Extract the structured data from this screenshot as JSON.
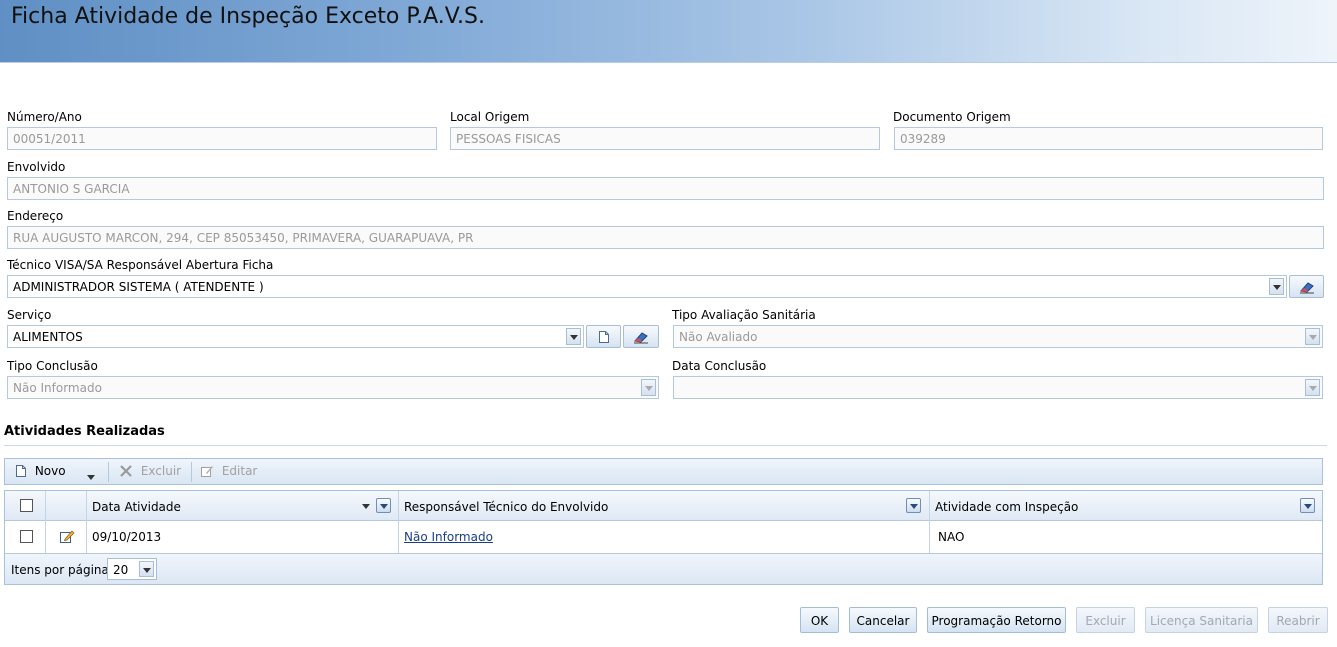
{
  "header": {
    "title": "Ficha Atividade de Inspeção Exceto P.A.V.S."
  },
  "form": {
    "numero_ano": {
      "label": "Número/Ano",
      "value": "00051/2011"
    },
    "local_origem": {
      "label": "Local Origem",
      "value": "PESSOAS FISICAS"
    },
    "documento_origem": {
      "label": "Documento Origem",
      "value": "039289"
    },
    "envolvido": {
      "label": "Envolvido",
      "value": "ANTONIO S GARCIA"
    },
    "endereco": {
      "label": "Endereço",
      "value": "RUA AUGUSTO MARCON, 294, CEP 85053450, PRIMAVERA, GUARAPUAVA, PR"
    },
    "tecnico": {
      "label": "Técnico VISA/SA Responsável Abertura Ficha",
      "value": "ADMINISTRADOR SISTEMA ( ATENDENTE )"
    },
    "servico": {
      "label": "Serviço",
      "value": "ALIMENTOS"
    },
    "tipo_avaliacao": {
      "label": "Tipo Avaliação Sanitária",
      "value": "Não Avaliado"
    },
    "tipo_conclusao": {
      "label": "Tipo Conclusão",
      "value": "Não Informado"
    },
    "data_conclusao": {
      "label": "Data Conclusão",
      "value": ""
    }
  },
  "activities": {
    "title": "Atividades Realizadas",
    "toolbar": {
      "novo": "Novo",
      "excluir": "Excluir",
      "editar": "Editar"
    },
    "columns": [
      "Data Atividade",
      "Responsável Técnico do Envolvido",
      "Atividade com Inspeção"
    ],
    "rows": [
      {
        "data": "09/10/2013",
        "responsavel": "Não Informado",
        "inspecao": "NAO"
      }
    ],
    "pager": {
      "label": "Itens por página:",
      "value": "20"
    }
  },
  "buttons": {
    "ok": "OK",
    "cancelar": "Cancelar",
    "programacao": "Programação Retorno",
    "excluir": "Excluir",
    "licenca": "Licença Sanitaria",
    "reabrir": "Reabrir"
  },
  "colors": {
    "accent": "#1a3e8c",
    "border": "#b5c9de",
    "header_start": "#5f8fc4"
  }
}
